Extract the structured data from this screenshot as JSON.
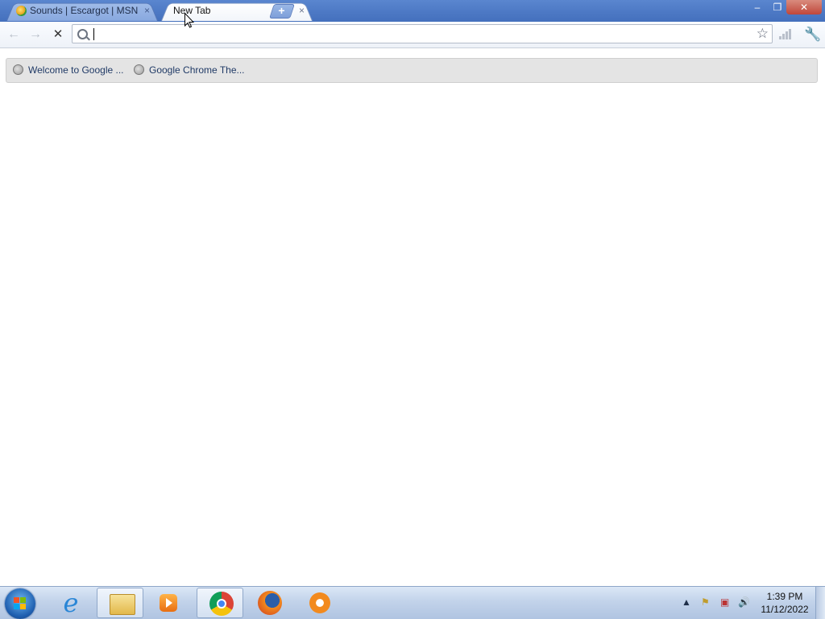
{
  "browser": {
    "tabs": [
      {
        "title": "Sounds | Escargot | MSN Me",
        "close": "×"
      },
      {
        "title": "New Tab",
        "close": "×"
      }
    ],
    "new_tab_symbol": "+",
    "window_controls": {
      "minimize": "–",
      "maximize": "❐",
      "close": "✕"
    }
  },
  "toolbar": {
    "back": "←",
    "forward": "→",
    "stop": "✕",
    "omnibox_value": "",
    "star": "☆",
    "wrench": "🔧"
  },
  "bookmarks": [
    {
      "label": "Welcome to Google ..."
    },
    {
      "label": "Google Chrome The..."
    }
  ],
  "taskbar": {
    "apps": [
      "internet-explorer-icon",
      "windows-explorer-icon",
      "media-player-icon",
      "chrome-icon",
      "firefox-icon",
      "avast-icon"
    ],
    "tray": {
      "up_arrow": "▲",
      "flag": "⚑",
      "network": "▣",
      "volume": "🔊"
    },
    "clock": {
      "time": "1:39 PM",
      "date": "11/12/2022"
    }
  }
}
